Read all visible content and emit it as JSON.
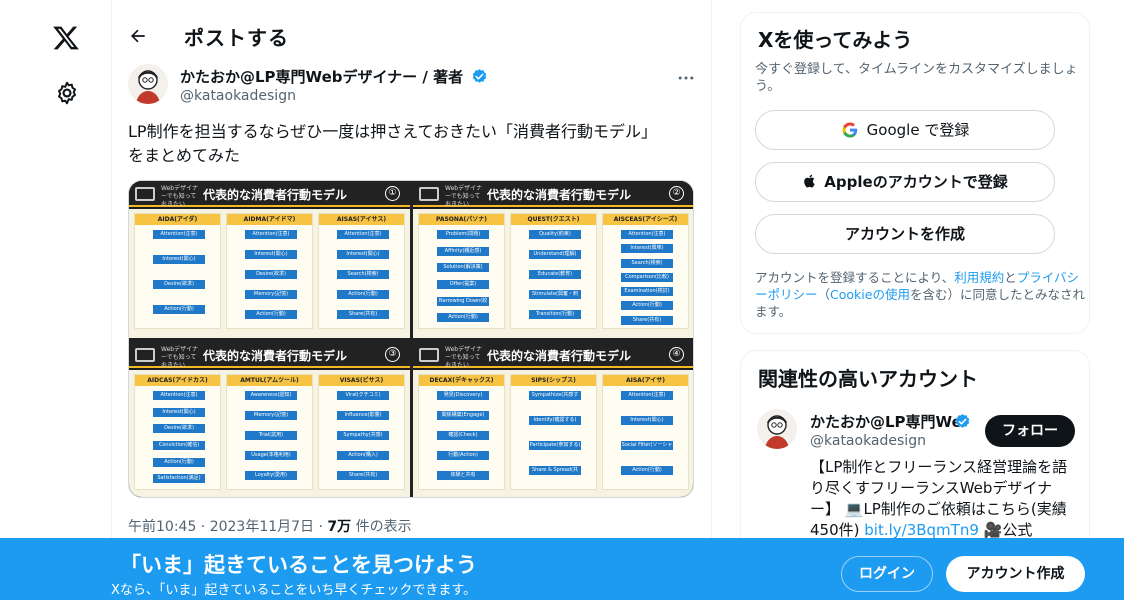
{
  "header": {
    "title": "ポストする"
  },
  "post": {
    "author_name": "かたおか@LP専門Webデザイナー / 著者",
    "author_handle": "@kataokadesign",
    "text_line1": "LP制作を担当するならぜひ一度は押さえておきたい「消費者行動モデル」",
    "text_line2": "をまとめてみた",
    "time": "午前10:45 · 2023年11月7日 · ",
    "views_count": "7万",
    "views_suffix": " 件の表示"
  },
  "media": {
    "panels": [
      {
        "subtitle": "Webデザイナーでも知っておきたい",
        "title": "代表的な消費者行動モデル",
        "number": "①",
        "columns": [
          {
            "title": "AIDA(アイダ)",
            "items": [
              "Attention(注意)",
              "Interest(関心)",
              "Desire(欲求)",
              "Action(行動)"
            ]
          },
          {
            "title": "AIDMA(アイドマ)",
            "items": [
              "Attention(注意)",
              "Interest(関心)",
              "Desire(欲求)",
              "Memory(記憶)",
              "Action(行動)"
            ]
          },
          {
            "title": "AISAS(アイサス)",
            "items": [
              "Attention(注意)",
              "Interest(関心)",
              "Search(検索)",
              "Action(行動)",
              "Share(共有)"
            ]
          }
        ]
      },
      {
        "subtitle": "Webデザイナーでも知っておきたい",
        "title": "代表的な消費者行動モデル",
        "number": "②",
        "columns": [
          {
            "title": "PASONA(パソナ)",
            "items": [
              "Problem(問題)",
              "Affinity(親近感)",
              "Solution(解決策)",
              "Offer(提案)",
              "Narrowing Down(絞込)",
              "Action(行動)"
            ]
          },
          {
            "title": "QUEST(クエスト)",
            "items": [
              "Quality(約束)",
              "Understand(理解)",
              "Educate(教育)",
              "Stimulate(興奮・刺激)",
              "Transition(行動)"
            ]
          },
          {
            "title": "AISCEAS(アイシーズ)",
            "items": [
              "Attention(注意)",
              "Interest(興味)",
              "Search(検索)",
              "Comparison(比較)",
              "Examination(検討)",
              "Action(行動)",
              "Share(共有)"
            ]
          }
        ]
      },
      {
        "subtitle": "Webデザイナーでも知っておきたい",
        "title": "代表的な消費者行動モデル",
        "number": "③",
        "columns": [
          {
            "title": "AIDCAS(アイドカス)",
            "items": [
              "Attention(注意)",
              "Interest(関心)",
              "Desire(欲求)",
              "Conviction(確信)",
              "Action(行動)",
              "Satisfaction(満足)"
            ]
          },
          {
            "title": "AMTUL(アムツール)",
            "items": [
              "Awareness(認知)",
              "Memory(記憶)",
              "Trial(試用)",
              "Usage(本格利用)",
              "Loyalty(愛用)"
            ]
          },
          {
            "title": "VISAS(ビサス)",
            "items": [
              "Viral(クチコミ)",
              "Influence(影響)",
              "Sympathy(共感)",
              "Action(購入)",
              "Share(共有)"
            ]
          }
        ]
      },
      {
        "subtitle": "Webデザイナーでも知っておきたい",
        "title": "代表的な消費者行動モデル",
        "number": "④",
        "columns": [
          {
            "title": "DECAX(デキャックス)",
            "items": [
              "発見(Discovery)",
              "関係構築(Engage)",
              "確認(Check)",
              "行動(Action)",
              "体験と共有(eXperience)"
            ]
          },
          {
            "title": "SIPS(シップス)",
            "items": [
              "Sympathize(共感する)",
              "Identify(確認する)",
              "Participate(参加する)",
              "Share & Spread(共有・拡散する)"
            ]
          },
          {
            "title": "AISA(アイサ)",
            "items": [
              "Attention(注意)",
              "Interest(関心)",
              "Social Filter(ソーシャルフィルター)",
              "Action(行動)"
            ]
          }
        ]
      }
    ]
  },
  "signup_card": {
    "title": "Xを使ってみよう",
    "description": "今すぐ登録して、タイムラインをカスタマイズしましょう。",
    "google_label": "Google で登録",
    "apple_label": "Appleのアカウントで登録",
    "create_label": "アカウントを作成",
    "legal_prefix": "アカウントを登録することにより、",
    "legal_terms": "利用規約",
    "legal_and": "と",
    "legal_privacy": "プライバシーポリシー",
    "legal_paren_open": "（",
    "legal_cookie": "Cookieの使用",
    "legal_suffix": "を含む）に同意したとみなされます。"
  },
  "related": {
    "title": "関連性の高いアカウント",
    "name": "かたおか@LP専門Webデザイナー / 著者",
    "handle": "@kataokadesign",
    "follow_label": "フォロー",
    "bio_text": "【LP制作とフリーランス経営理論を語り尽くすフリーランスWebデザイナー】 💻LP制作のご依頼はこちら(実績450件) ",
    "bio_link": "bit.ly/3BqmTn9",
    "bio_tail": " 🎥公式"
  },
  "banner": {
    "headline": "「いま」起きていることを見つけよう",
    "subline": "Xなら、「いま」起きていることをいち早くチェックできます。",
    "login_label": "ログイン",
    "signup_label": "アカウント作成"
  },
  "colors": {
    "accent": "#1d9bf0",
    "text": "#0f1419",
    "muted": "#536471",
    "verified": "#1d9bf0"
  }
}
